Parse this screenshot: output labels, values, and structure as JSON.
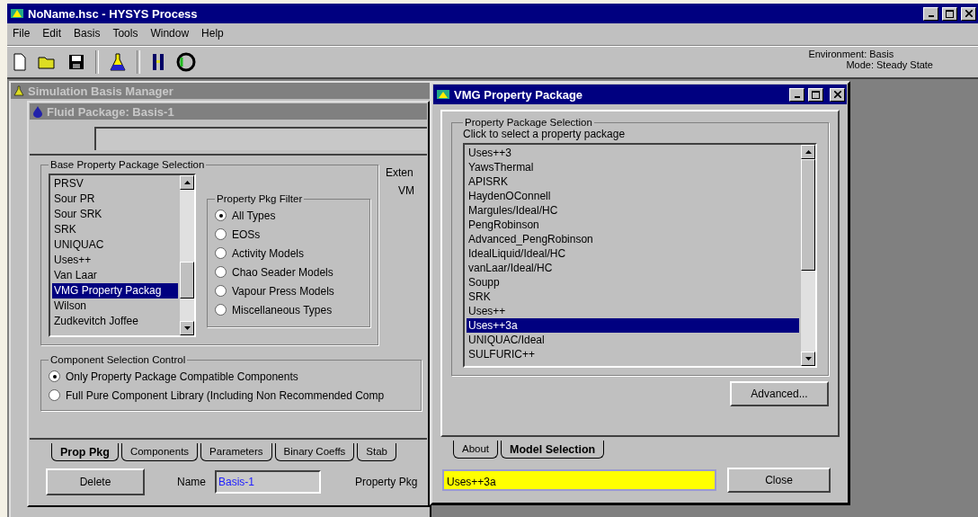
{
  "app_window": {
    "title": "NoName.hsc - HYSYS Process"
  },
  "menu": [
    "File",
    "Edit",
    "Basis",
    "Tools",
    "Window",
    "Help"
  ],
  "status": {
    "environment": "Environment: Basis",
    "mode": "Mode: Steady State"
  },
  "basis_manager": {
    "title": "Simulation Basis Manager",
    "active": false
  },
  "fluid_package": {
    "title": "Fluid Package: Basis-1",
    "active": false,
    "base_selection": {
      "legend": "Base Property Package Selection",
      "items": [
        {
          "label": "PRSV",
          "selected": false
        },
        {
          "label": "Sour PR",
          "selected": false
        },
        {
          "label": "Sour SRK",
          "selected": false
        },
        {
          "label": "SRK",
          "selected": false
        },
        {
          "label": "UNIQUAC",
          "selected": false
        },
        {
          "label": "Uses++",
          "selected": false
        },
        {
          "label": "Van Laar",
          "selected": false
        },
        {
          "label": "VMG Property Packag",
          "selected": true
        },
        {
          "label": "Wilson",
          "selected": false
        },
        {
          "label": "Zudkevitch Joffee",
          "selected": false
        }
      ]
    },
    "extended_label": "Exten",
    "extended_value": "VM",
    "filter": {
      "legend": "Property Pkg Filter",
      "options": [
        {
          "label": "All Types",
          "selected": true
        },
        {
          "label": "EOSs",
          "selected": false
        },
        {
          "label": "Activity Models",
          "selected": false
        },
        {
          "label": "Chao Seader Models",
          "selected": false
        },
        {
          "label": "Vapour Press Models",
          "selected": false
        },
        {
          "label": "Miscellaneous Types",
          "selected": false
        }
      ]
    },
    "component_control": {
      "legend": "Component Selection Control",
      "options": [
        {
          "label": "Only Property Package Compatible Components",
          "selected": true
        },
        {
          "label": "Full Pure Component Library (Including Non Recommended Comp",
          "selected": false
        }
      ]
    },
    "tabs": [
      {
        "label": "Prop Pkg",
        "selected": true
      },
      {
        "label": "Components",
        "selected": false
      },
      {
        "label": "Parameters",
        "selected": false
      },
      {
        "label": "Binary Coeffs",
        "selected": false
      },
      {
        "label": "Stab",
        "selected": false
      }
    ],
    "delete_button": "Delete",
    "name_label": "Name",
    "name_value": "Basis-1",
    "property_pkg_label": "Property Pkg"
  },
  "vmg_window": {
    "title": "VMG Property Package",
    "active": true,
    "group_legend": "Property Package Selection",
    "hint": "Click to select a property package",
    "items": [
      {
        "label": "Uses++3",
        "selected": false
      },
      {
        "label": "YawsThermal",
        "selected": false
      },
      {
        "label": "APISRK",
        "selected": false
      },
      {
        "label": "HaydenOConnell",
        "selected": false
      },
      {
        "label": "Margules/Ideal/HC",
        "selected": false
      },
      {
        "label": "PengRobinson",
        "selected": false
      },
      {
        "label": "Advanced_PengRobinson",
        "selected": false
      },
      {
        "label": "IdealLiquid/Ideal/HC",
        "selected": false
      },
      {
        "label": "vanLaar/Ideal/HC",
        "selected": false
      },
      {
        "label": "Soupp",
        "selected": false
      },
      {
        "label": "SRK",
        "selected": false
      },
      {
        "label": "Uses++",
        "selected": false
      },
      {
        "label": "Uses++3a",
        "selected": true
      },
      {
        "label": "UNIQUAC/Ideal",
        "selected": false
      },
      {
        "label": "SULFURIC++",
        "selected": false
      }
    ],
    "advanced_button": "Advanced...",
    "tabs": [
      {
        "label": "About",
        "selected": false
      },
      {
        "label": "Model Selection",
        "selected": true
      }
    ],
    "selected_value": "Uses++3a",
    "close_button": "Close"
  }
}
